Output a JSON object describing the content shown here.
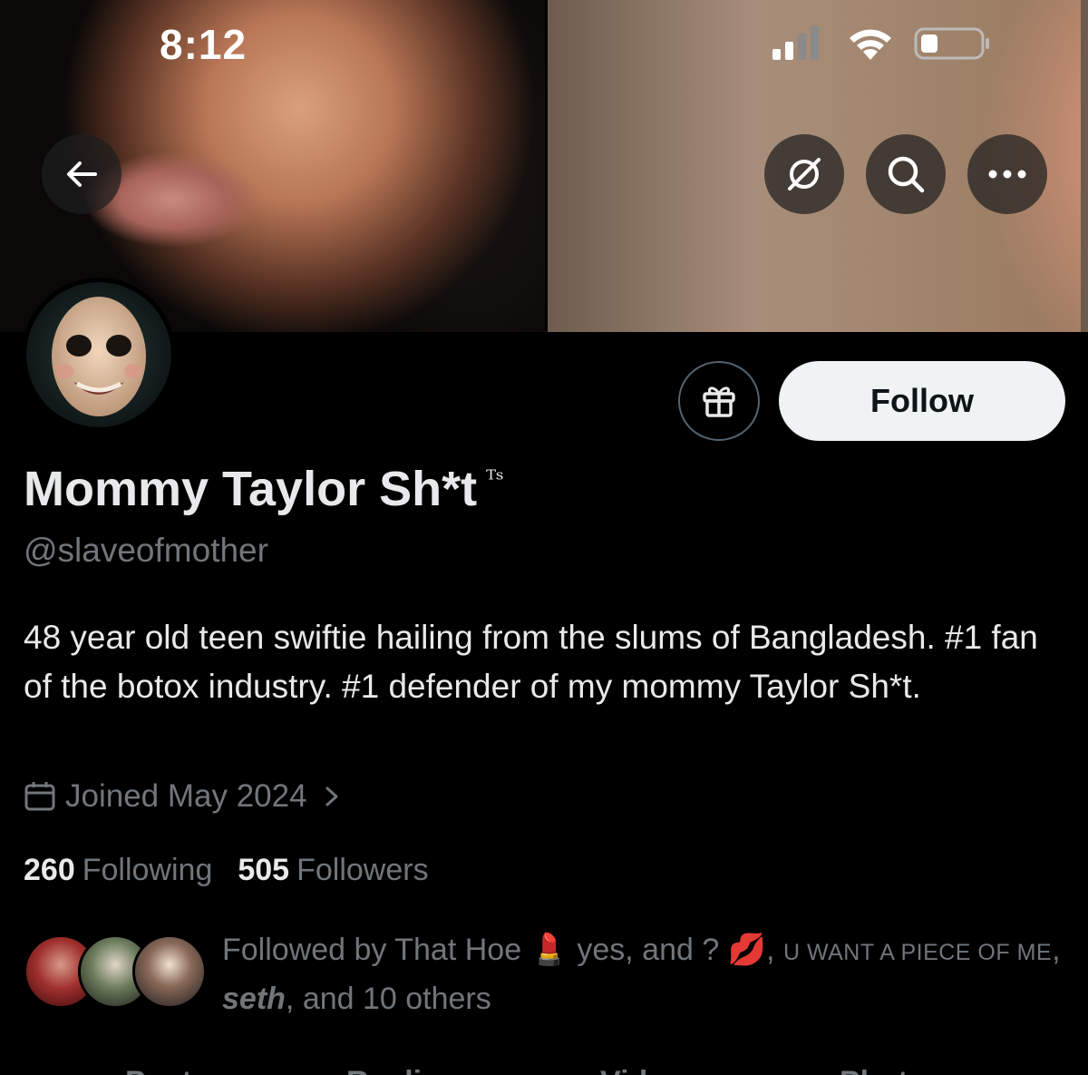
{
  "status_bar": {
    "time": "8:12",
    "signal_icon": "cellular-signal-icon",
    "wifi_icon": "wifi-icon",
    "battery_icon": "battery-icon"
  },
  "banner": {
    "back_icon": "arrow-left-icon",
    "grok_icon": "grok-icon",
    "search_icon": "search-icon",
    "more_icon": "more-horizontal-icon"
  },
  "profile": {
    "display_name": "Mommy Taylor Sh*t",
    "name_suffix": "ᵀˢ",
    "handle": "@slaveofmother",
    "bio": "48 year old teen swiftie hailing from the slums of Bangladesh. #1 fan of the botox industry. #1 defender of my mommy Taylor Sh*t.",
    "joined": "Joined May 2024",
    "following_count": "260",
    "following_label": "Following",
    "followers_count": "505",
    "followers_label": "Followers"
  },
  "actions": {
    "gift_icon": "gift-icon",
    "follow_label": "Follow"
  },
  "followed_by": {
    "prefix": "Followed by That Hoe",
    "emoji_1": "💄",
    "part_2": " yes, and ? ",
    "emoji_2": "💋",
    "part_3": ", ",
    "caps_name": "U WANT A PIECE OF ME",
    "part_4": ",",
    "name_3": "seth",
    "suffix": ", and 10 others"
  },
  "tabs": [
    "Posts",
    "Replies",
    "Videos",
    "Photos"
  ],
  "colors": {
    "background": "#000000",
    "text_primary": "#e7e9ea",
    "text_secondary": "#71767b",
    "follow_button": "#eff3f4",
    "border": "#536471"
  }
}
